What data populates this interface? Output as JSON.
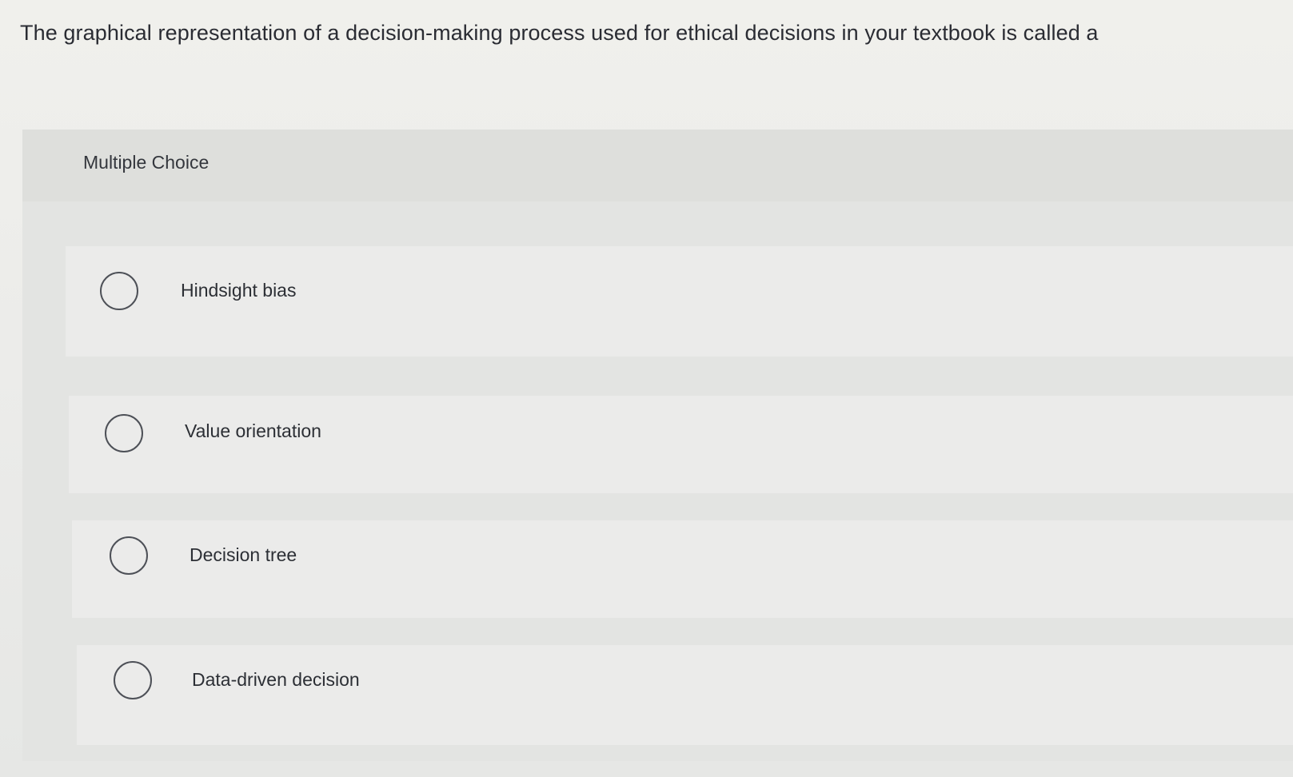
{
  "question": {
    "text": "The graphical representation of a decision-making process used for ethical decisions in your textbook is called a"
  },
  "panel": {
    "title": "Multiple Choice"
  },
  "options": [
    {
      "label": "Hindsight bias",
      "selected": false
    },
    {
      "label": "Value orientation",
      "selected": false
    },
    {
      "label": "Decision tree",
      "selected": false
    },
    {
      "label": "Data-driven decision",
      "selected": false
    }
  ],
  "colors": {
    "background": "#ecece9",
    "panel": "#e3e4e2",
    "option_background": "#ebebea",
    "text": "#2b2d33",
    "radio_border": "#4d5057"
  }
}
